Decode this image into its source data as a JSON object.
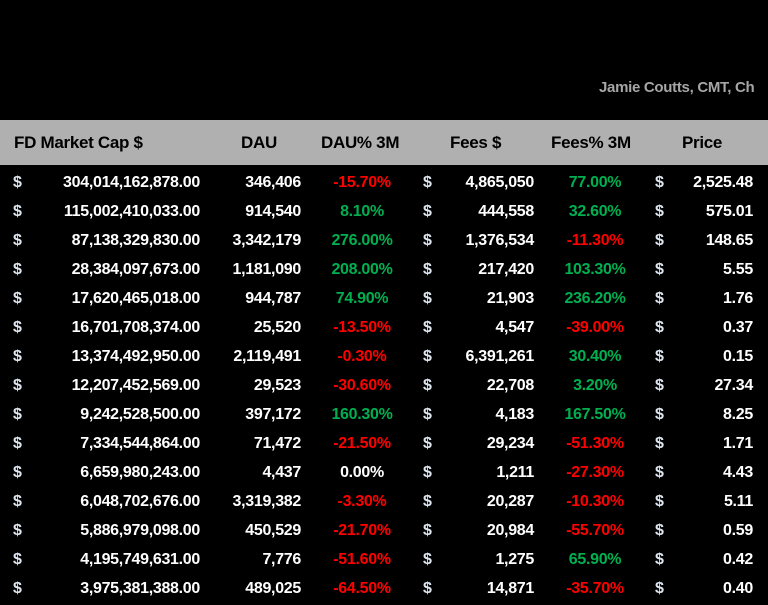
{
  "author": "Jamie Coutts, CMT, Ch",
  "colors": {
    "header_bg": "#b0b0b0",
    "negative": "#ff0000",
    "positive": "#00b050",
    "neutral": "#ffffff"
  },
  "headers": [
    "FD Market Cap $",
    "DAU",
    "DAU% 3M",
    "Fees $",
    "Fees% 3M",
    "Price"
  ],
  "currency_symbol": "$",
  "rows": [
    {
      "mcap": "304,014,162,878.00",
      "dau": "346,406",
      "dau_pct": "-15.70%",
      "fees": "4,865,050",
      "fees_pct": "77.00%",
      "price": "2,525.48"
    },
    {
      "mcap": "115,002,410,033.00",
      "dau": "914,540",
      "dau_pct": "8.10%",
      "fees": "444,558",
      "fees_pct": "32.60%",
      "price": "575.01"
    },
    {
      "mcap": "87,138,329,830.00",
      "dau": "3,342,179",
      "dau_pct": "276.00%",
      "fees": "1,376,534",
      "fees_pct": "-11.30%",
      "price": "148.65"
    },
    {
      "mcap": "28,384,097,673.00",
      "dau": "1,181,090",
      "dau_pct": "208.00%",
      "fees": "217,420",
      "fees_pct": "103.30%",
      "price": "5.55"
    },
    {
      "mcap": "17,620,465,018.00",
      "dau": "944,787",
      "dau_pct": "74.90%",
      "fees": "21,903",
      "fees_pct": "236.20%",
      "price": "1.76"
    },
    {
      "mcap": "16,701,708,374.00",
      "dau": "25,520",
      "dau_pct": "-13.50%",
      "fees": "4,547",
      "fees_pct": "-39.00%",
      "price": "0.37"
    },
    {
      "mcap": "13,374,492,950.00",
      "dau": "2,119,491",
      "dau_pct": "-0.30%",
      "fees": "6,391,261",
      "fees_pct": "30.40%",
      "price": "0.15"
    },
    {
      "mcap": "12,207,452,569.00",
      "dau": "29,523",
      "dau_pct": "-30.60%",
      "fees": "22,708",
      "fees_pct": "3.20%",
      "price": "27.34"
    },
    {
      "mcap": "9,242,528,500.00",
      "dau": "397,172",
      "dau_pct": "160.30%",
      "fees": "4,183",
      "fees_pct": "167.50%",
      "price": "8.25"
    },
    {
      "mcap": "7,334,544,864.00",
      "dau": "71,472",
      "dau_pct": "-21.50%",
      "fees": "29,234",
      "fees_pct": "-51.30%",
      "price": "1.71"
    },
    {
      "mcap": "6,659,980,243.00",
      "dau": "4,437",
      "dau_pct": "0.00%",
      "fees": "1,211",
      "fees_pct": "-27.30%",
      "price": "4.43"
    },
    {
      "mcap": "6,048,702,676.00",
      "dau": "3,319,382",
      "dau_pct": "-3.30%",
      "fees": "20,287",
      "fees_pct": "-10.30%",
      "price": "5.11"
    },
    {
      "mcap": "5,886,979,098.00",
      "dau": "450,529",
      "dau_pct": "-21.70%",
      "fees": "20,984",
      "fees_pct": "-55.70%",
      "price": "0.59"
    },
    {
      "mcap": "4,195,749,631.00",
      "dau": "7,776",
      "dau_pct": "-51.60%",
      "fees": "1,275",
      "fees_pct": "65.90%",
      "price": "0.42"
    },
    {
      "mcap": "3,975,381,388.00",
      "dau": "489,025",
      "dau_pct": "-64.50%",
      "fees": "14,871",
      "fees_pct": "-35.70%",
      "price": "0.40"
    }
  ]
}
